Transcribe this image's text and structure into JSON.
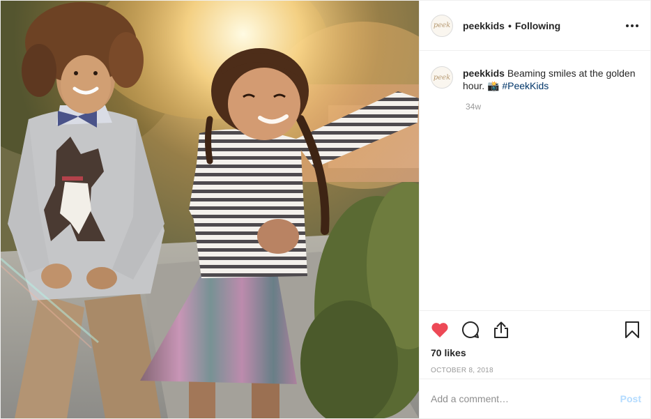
{
  "header": {
    "username": "peekkids",
    "separator": "•",
    "follow_status": "Following",
    "avatar_text": "peek"
  },
  "caption": {
    "username": "peekkids",
    "text": " Beaming smiles at the golden hour. 📸 ",
    "hashtag": "#PeekKids",
    "avatar_text": "peek",
    "time_ago": "34w"
  },
  "actions": {
    "liked": true,
    "like_color": "#ed4956"
  },
  "likes": "70 likes",
  "date": "OCTOBER 8, 2018",
  "comment_box": {
    "placeholder": "Add a comment…",
    "post_label": "Post",
    "post_color": "#b3dbff"
  },
  "colors": {
    "hashtag": "#003569",
    "muted": "#999999",
    "border": "#efefef"
  },
  "icons": [
    "heart-icon",
    "comment-icon",
    "share-icon",
    "bookmark-icon",
    "more-options-icon"
  ]
}
